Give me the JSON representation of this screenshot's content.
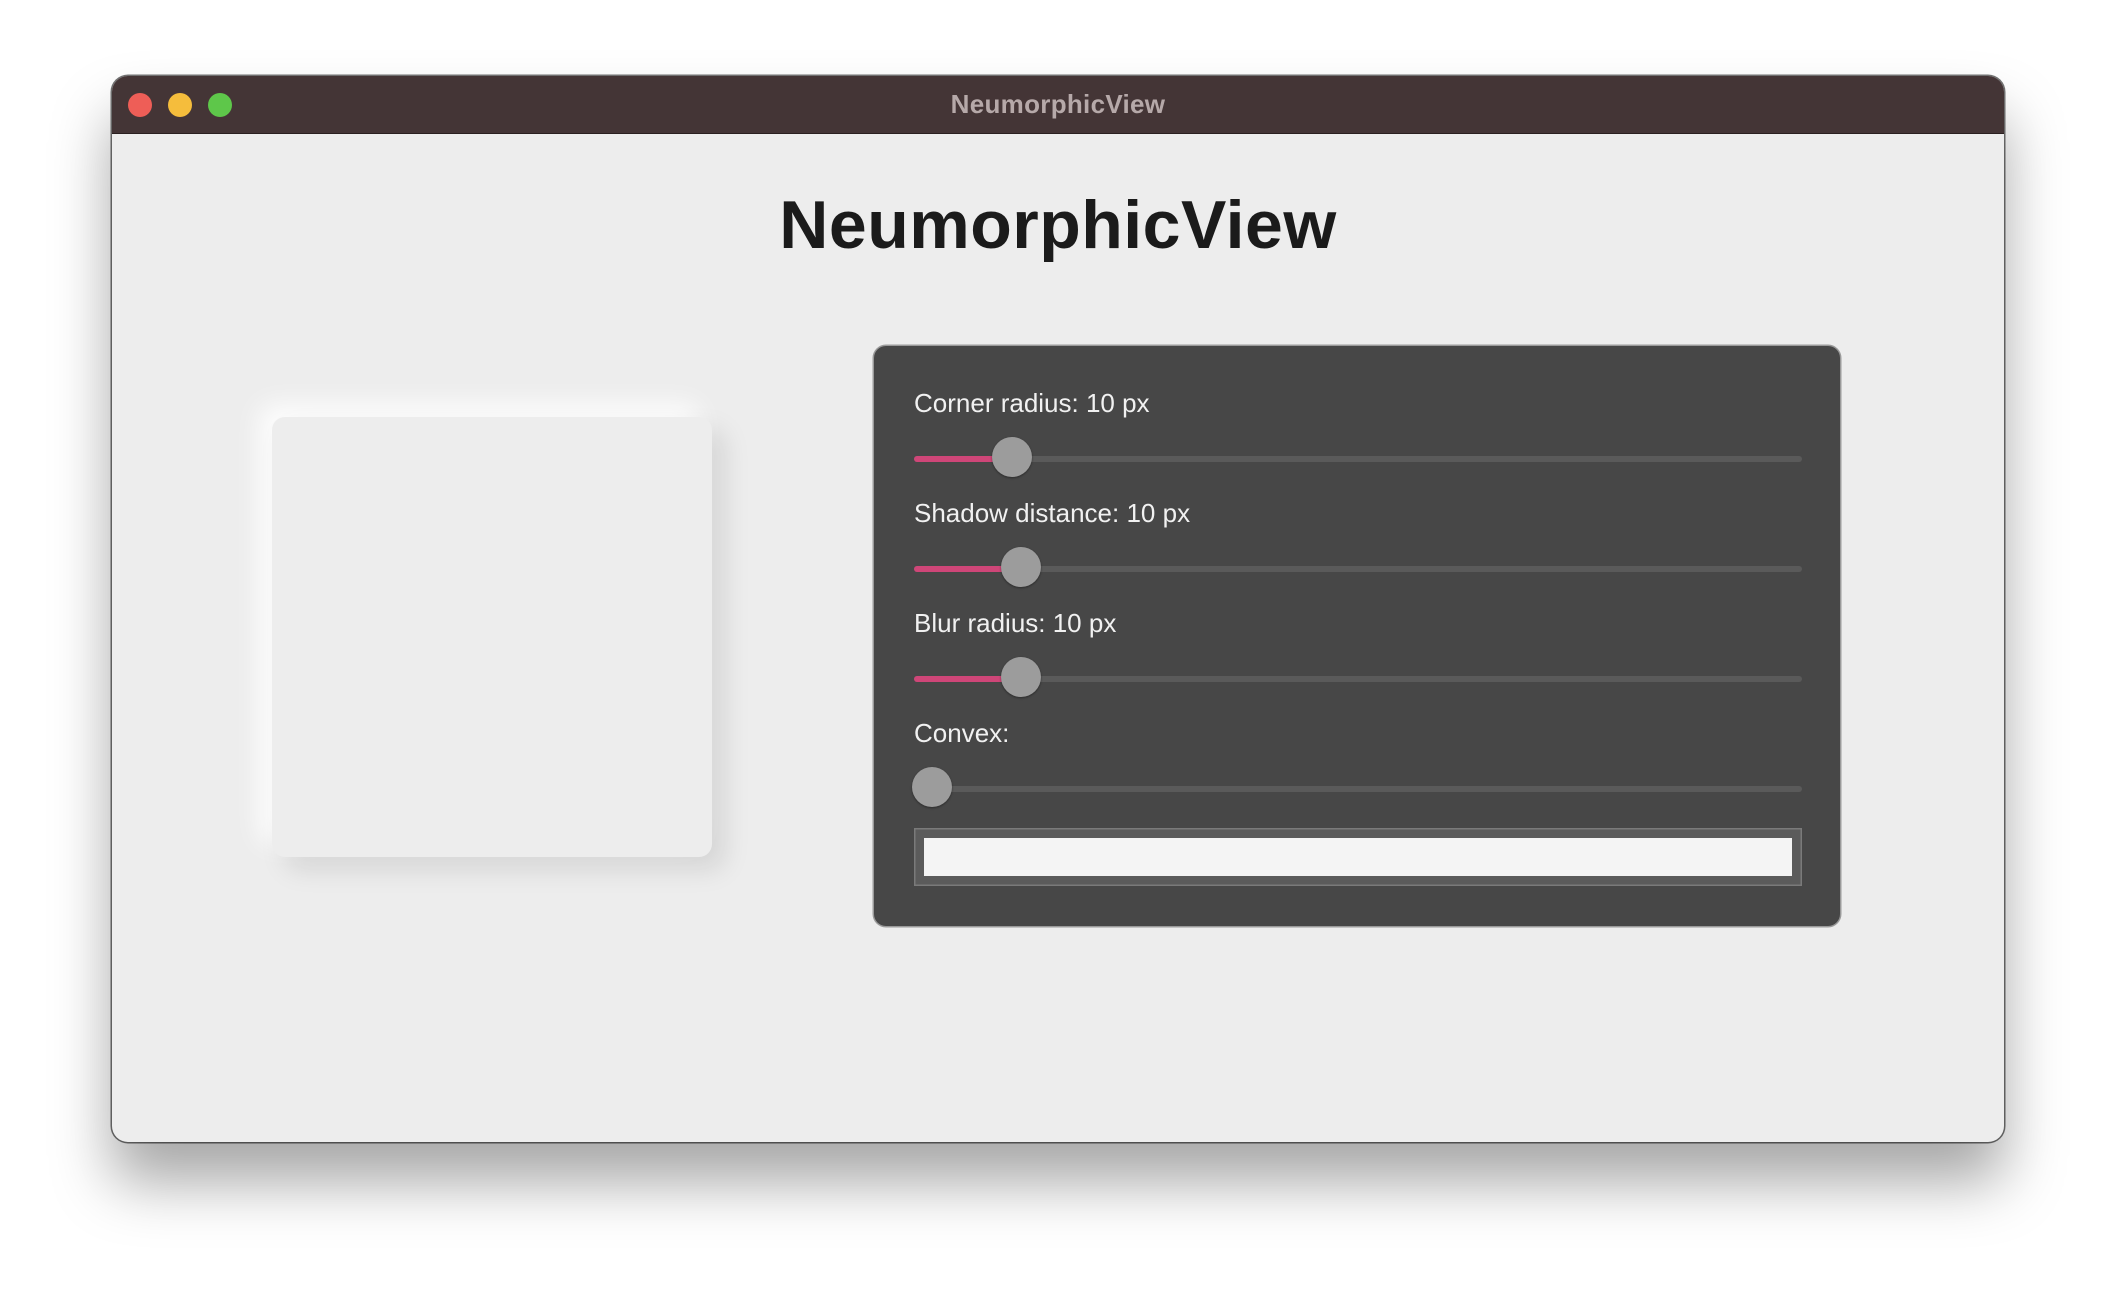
{
  "window": {
    "title": "NeumorphicView"
  },
  "heading": "NeumorphicView",
  "controls": {
    "corner_radius": {
      "label": "Corner radius: 10 px",
      "value_fraction": 0.11
    },
    "shadow_distance": {
      "label": "Shadow distance: 10 px",
      "value_fraction": 0.12
    },
    "blur_radius": {
      "label": "Blur radius: 10 px",
      "value_fraction": 0.12
    },
    "convex": {
      "label": "Convex:",
      "value_fraction": 0.02
    },
    "text_input": {
      "value": "",
      "placeholder": ""
    }
  },
  "colors": {
    "titlebar": "#443536",
    "slider_fill": "#cf4678",
    "panel": "#474747",
    "background": "#ededed"
  }
}
